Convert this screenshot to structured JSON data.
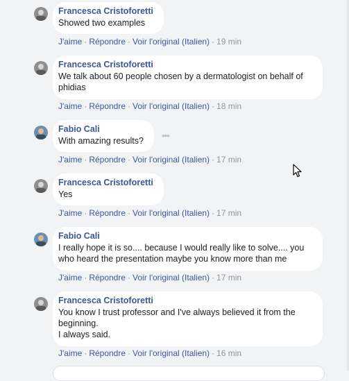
{
  "actions": {
    "like": "J'aime",
    "reply": "Répondre",
    "see_original": "Voir l'original (Italien)",
    "separator": "·"
  },
  "comments": [
    {
      "author": "Francesca Cristoforetti",
      "text": "Showed two examples",
      "time": "19 min",
      "avatar": "photo-avatar-gray"
    },
    {
      "author": "Francesca Cristoforetti",
      "text": "We talk about 60 people chosen by a dermatologist on behalf of\nphidias",
      "time": "18 min",
      "avatar": "photo-avatar-gray"
    },
    {
      "author": "Fabio Cali",
      "text": "With amazing results?",
      "time": "17 min",
      "avatar": "photo-avatar-color"
    },
    {
      "author": "Francesca Cristoforetti",
      "text": "Yes",
      "time": "17 min",
      "avatar": "photo-avatar-gray"
    },
    {
      "author": "Fabio Cali",
      "text": "I really hope it is so.... because I would really like to solve.... you\nwho heard the presentation maybe you know more than me",
      "time": "17 min",
      "avatar": "photo-avatar-color"
    },
    {
      "author": "Francesca Cristoforetti",
      "text": "You know I trust professor and I've always believed it from the\nbeginning.\nI always said.",
      "time": "16 min",
      "avatar": "photo-avatar-gray"
    }
  ],
  "icons": {
    "more_options": "more-horizontal-icon",
    "cursor": "mouse-pointer-icon"
  },
  "colors": {
    "background": "#f2f3f5",
    "bubble": "#ffffff",
    "author_link": "#385898",
    "action_link": "#385898",
    "timestamp": "#90949c"
  }
}
